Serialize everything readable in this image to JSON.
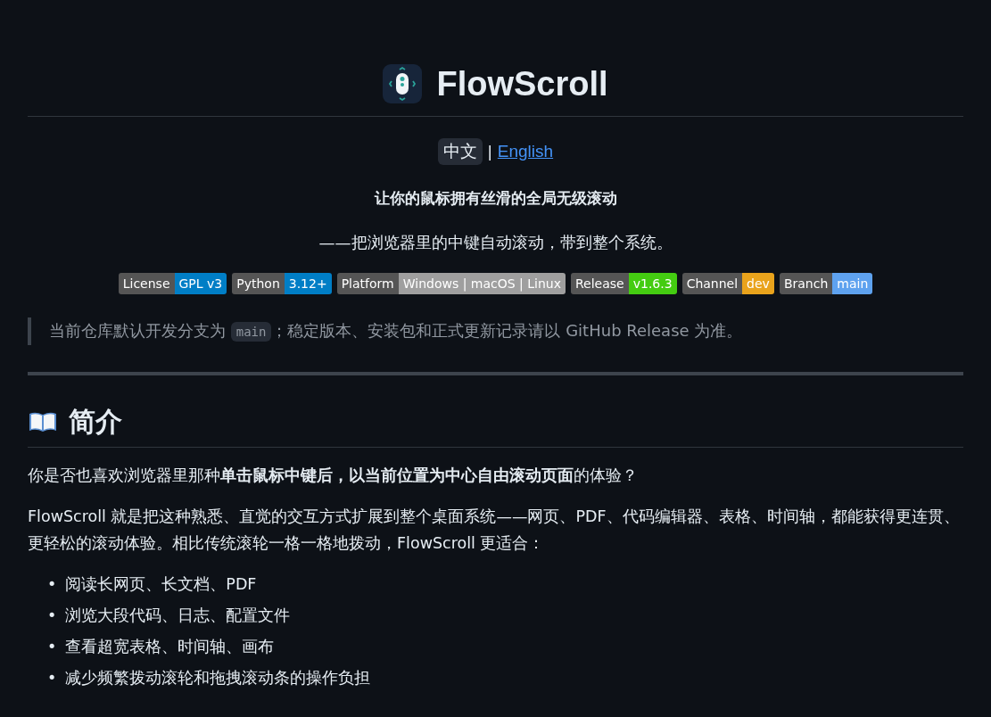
{
  "title": "FlowScroll",
  "languages": [
    {
      "label": "中文",
      "selected": true
    },
    {
      "label": "English",
      "selected": false
    }
  ],
  "language_separator": "|",
  "tagline": "让你的鼠标拥有丝滑的全局无级滚动",
  "subtitle": "——把浏览器里的中键自动滚动，带到整个系统。",
  "badges": [
    {
      "label": "License",
      "value": "GPL v3",
      "color": "#007ec6"
    },
    {
      "label": "Python",
      "value": "3.12+",
      "color": "#007ec6"
    },
    {
      "label": "Platform",
      "value": "Windows | macOS | Linux",
      "color": "#9f9f9f"
    },
    {
      "label": "Release",
      "value": "v1.6.3",
      "color": "#44cc11"
    },
    {
      "label": "Channel",
      "value": "dev",
      "color": "#e9a31c"
    },
    {
      "label": "Branch",
      "value": "main",
      "color": "#5ea2ef"
    }
  ],
  "note": {
    "before": "当前仓库默认开发分支为 ",
    "code": "main",
    "after": "；稳定版本、安装包和正式更新记录请以 GitHub Release 为准。"
  },
  "section": {
    "heading": "简介",
    "paragraphs": [
      "你是否也喜欢浏览器里那种**单击鼠标中键后，以当前位置为中心自由滚动页面**的体验？",
      "FlowScroll 就是把这种熟悉、直觉的交互方式扩展到整个桌面系统——网页、PDF、代码编辑器、表格、时间轴，都能获得更连贯、更轻松的滚动体验。相比传统滚轮一格一格地拨动，FlowScroll 更适合："
    ],
    "list_marker": "•",
    "list": [
      "阅读长网页、长文档、PDF",
      "浏览大段代码、日志、配置文件",
      "查看超宽表格、时间轴、画布",
      "减少频繁拨动滚轮和拖拽滚动条的操作负担"
    ]
  }
}
